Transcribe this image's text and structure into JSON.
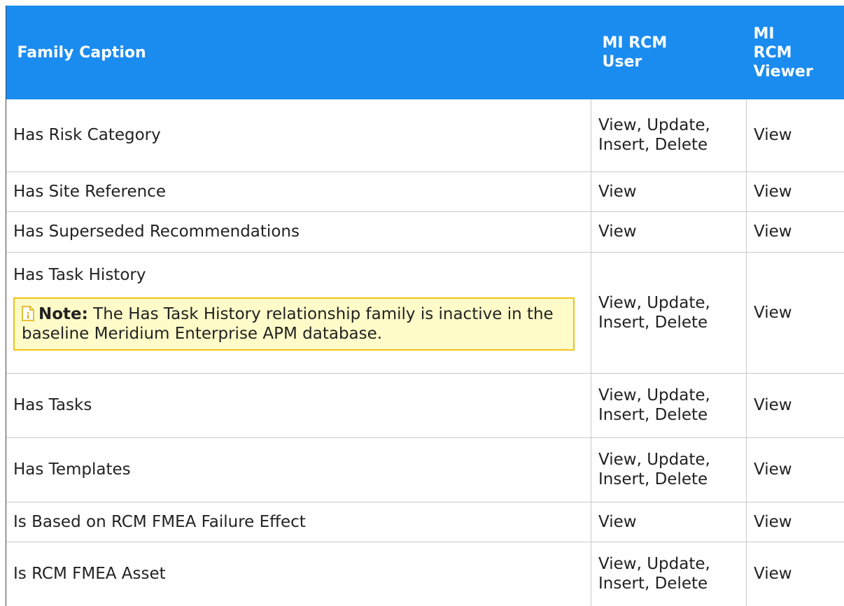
{
  "header": {
    "family_caption": "Family Caption",
    "rcm_user": "MI RCM User",
    "rcm_viewer": "MI RCM Viewer"
  },
  "rows": [
    {
      "caption": "Has Risk Category",
      "user": "View, Update, Insert, Delete",
      "viewer": "View"
    },
    {
      "caption": "Has Site Reference",
      "user": "View",
      "viewer": "View"
    },
    {
      "caption": "Has Superseded Recommendations",
      "user": "View",
      "viewer": "View"
    },
    {
      "caption": "Has Task History",
      "user": "View, Update, Insert, Delete",
      "viewer": "View"
    },
    {
      "caption": "Has Tasks",
      "user": "View, Update, Insert, Delete",
      "viewer": "View"
    },
    {
      "caption": "Has Templates",
      "user": "View, Update, Insert, Delete",
      "viewer": "View"
    },
    {
      "caption": "Is Based on RCM FMEA Failure Effect",
      "user": "View",
      "viewer": "View"
    },
    {
      "caption": "Is RCM FMEA Asset",
      "user": "View, Update, Insert, Delete",
      "viewer": "View"
    }
  ],
  "note": {
    "label": "Note:",
    "text": "The Has Task History relationship family is inactive in the baseline Meridium Enterprise APM database.",
    "icon": "note-info-icon"
  },
  "colors": {
    "header_bg": "#1a8cf0",
    "header_text": "#ffffff",
    "note_bg": "#fffcc9",
    "note_border": "#f2c21b",
    "grid": "#c9c9c9"
  }
}
